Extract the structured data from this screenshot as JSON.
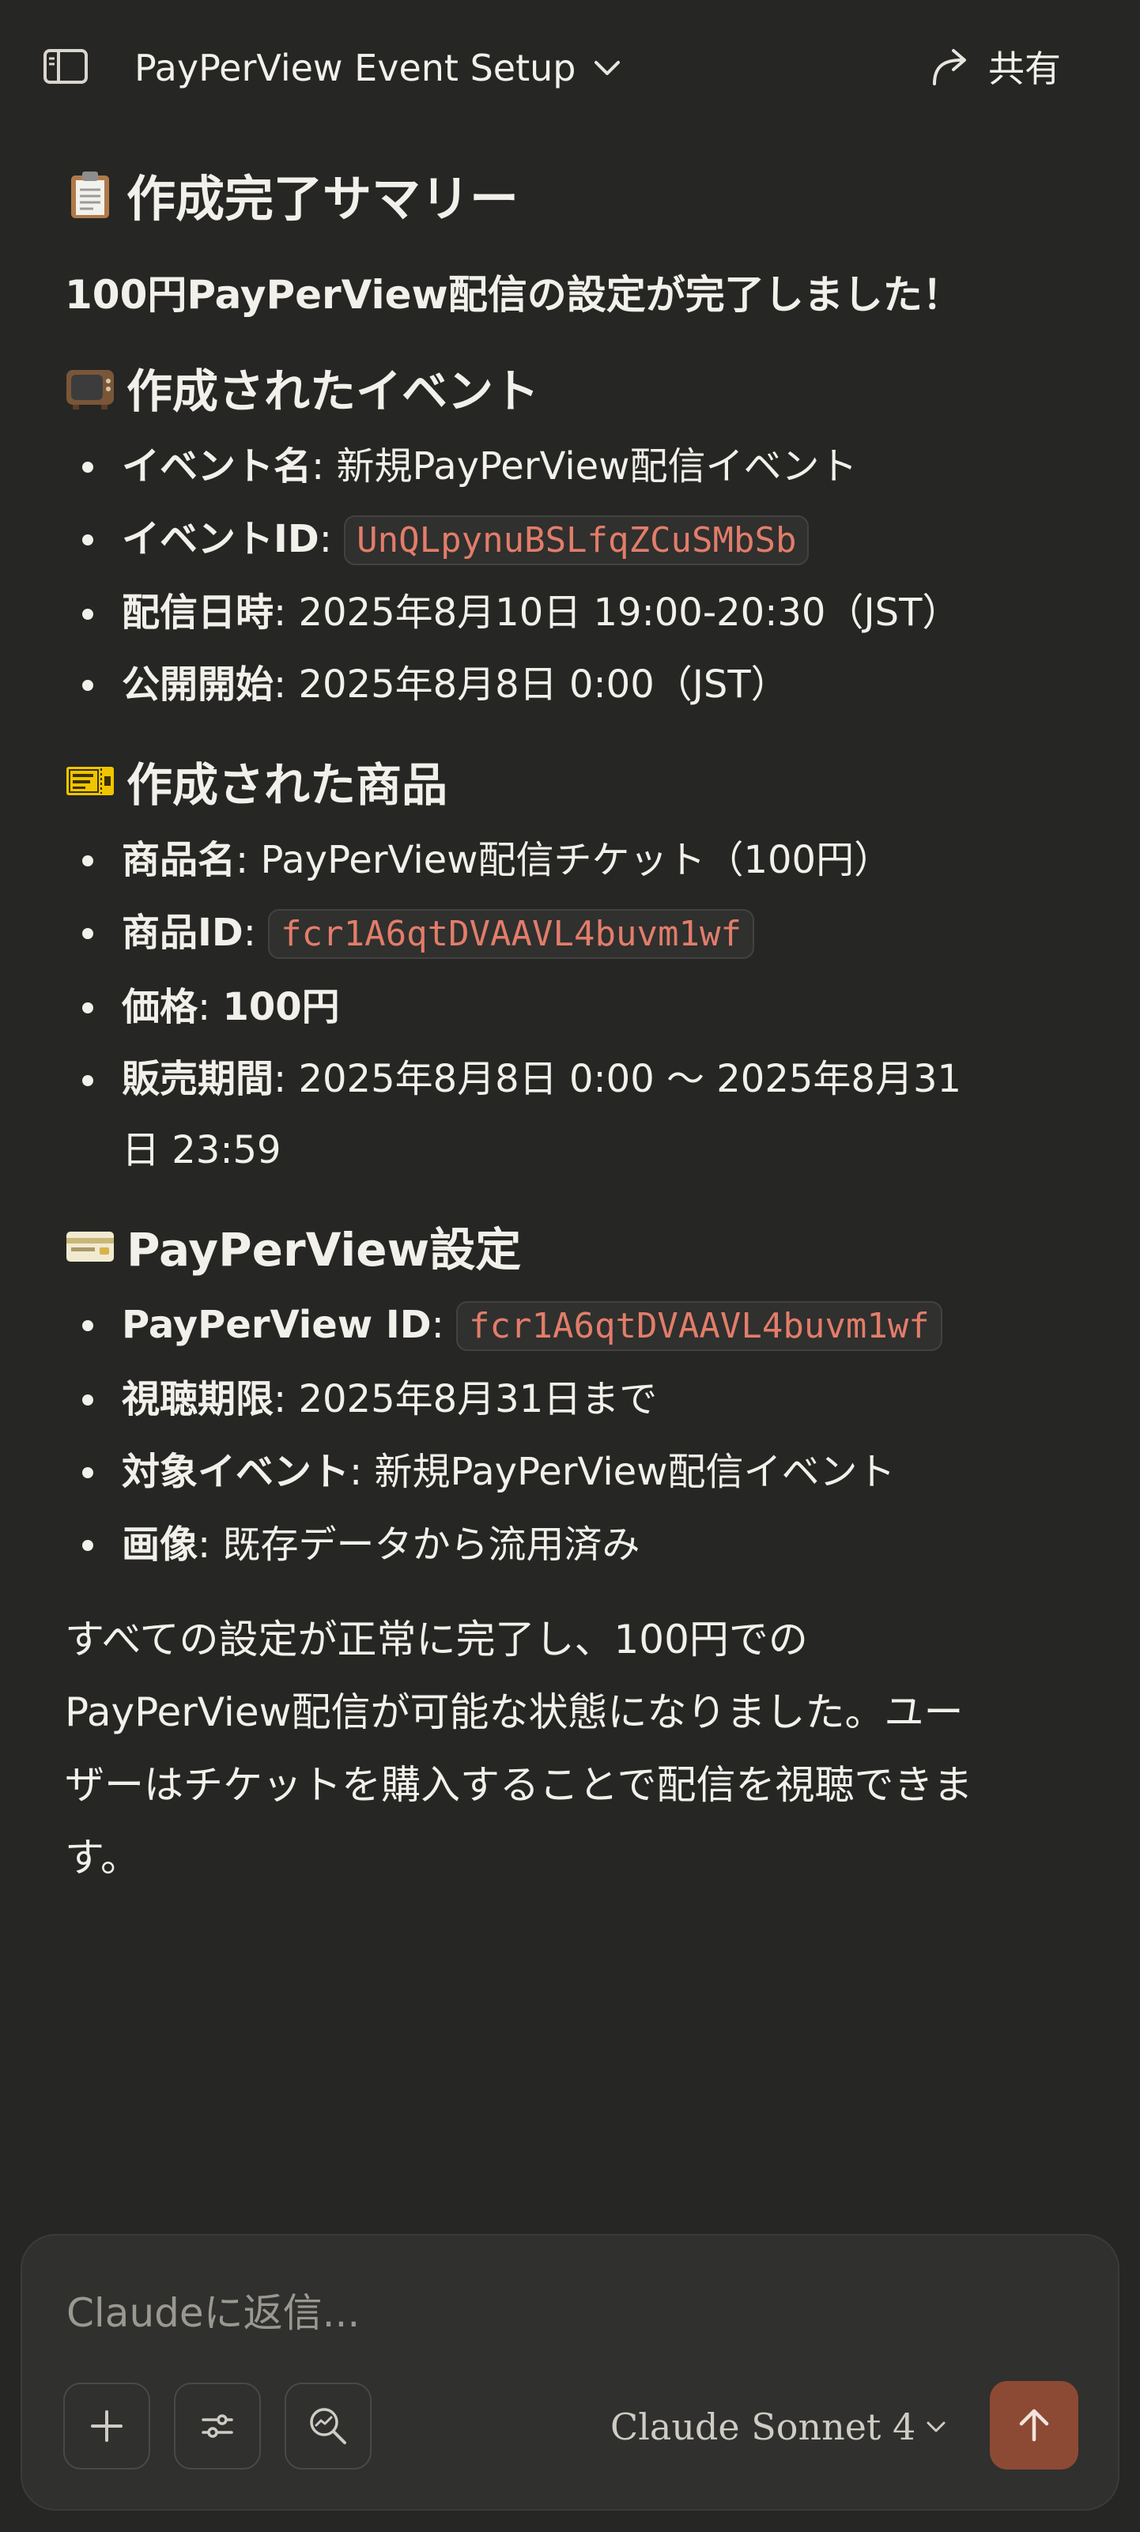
{
  "header": {
    "title": "PayPerView Event Setup",
    "share_label": "共有"
  },
  "summary": {
    "heading": "作成完了サマリー",
    "lead": "100円PayPerView配信の設定が完了しました！"
  },
  "event": {
    "heading": "作成されたイベント",
    "items": [
      {
        "key": "イベント名",
        "sep": ": ",
        "value": "新規PayPerView配信イベント"
      },
      {
        "key": "イベントID",
        "sep": ": ",
        "code": "UnQLpynuBSLfqZCuSMbSb"
      },
      {
        "key": "配信日時",
        "sep": ": ",
        "value": "2025年8月10日 19:00-20:30（JST）"
      },
      {
        "key": "公開開始",
        "sep": ": ",
        "value": "2025年8月8日 0:00（JST）"
      }
    ]
  },
  "product": {
    "heading": "作成された商品",
    "items": [
      {
        "key": "商品名",
        "sep": ": ",
        "value": "PayPerView配信チケット（100円）"
      },
      {
        "key": "商品ID",
        "sep": ": ",
        "code": "fcr1A6qtDVAAVL4buvm1wf"
      },
      {
        "key": "価格",
        "sep": ": ",
        "value_bold": "100円"
      },
      {
        "key": "販売期間",
        "sep": ": ",
        "value": "2025年8月8日 0:00 〜 2025年8月31日 23:59"
      }
    ]
  },
  "ppv": {
    "heading": "PayPerView設定",
    "items": [
      {
        "key": "PayPerView ID",
        "sep": ": ",
        "code": "fcr1A6qtDVAAVL4buvm1wf"
      },
      {
        "key": "視聴期限",
        "sep": ": ",
        "value": "2025年8月31日まで"
      },
      {
        "key": "対象イベント",
        "sep": ": ",
        "value": "新規PayPerView配信イベント"
      },
      {
        "key": "画像",
        "sep": ": ",
        "value": "既存データから流用済み"
      }
    ]
  },
  "closing": "すべての設定が正常に完了し、100円でのPayPerView配信が可能な状態になりました。ユーザーはチケットを購入することで配信を視聴できます。",
  "composer": {
    "placeholder": "Claudeに返信...",
    "model": "Claude Sonnet 4"
  },
  "icons": {
    "sidebar": "sidebar-toggle-icon",
    "chevron": "chevron-down-icon",
    "share": "share-arrow-icon",
    "plus": "plus-icon",
    "sliders": "sliders-icon",
    "research": "research-search-icon",
    "send": "arrow-up-icon"
  },
  "colors": {
    "background": "#262624",
    "code": "#e27d6a",
    "send_button": "#8c4a35"
  }
}
